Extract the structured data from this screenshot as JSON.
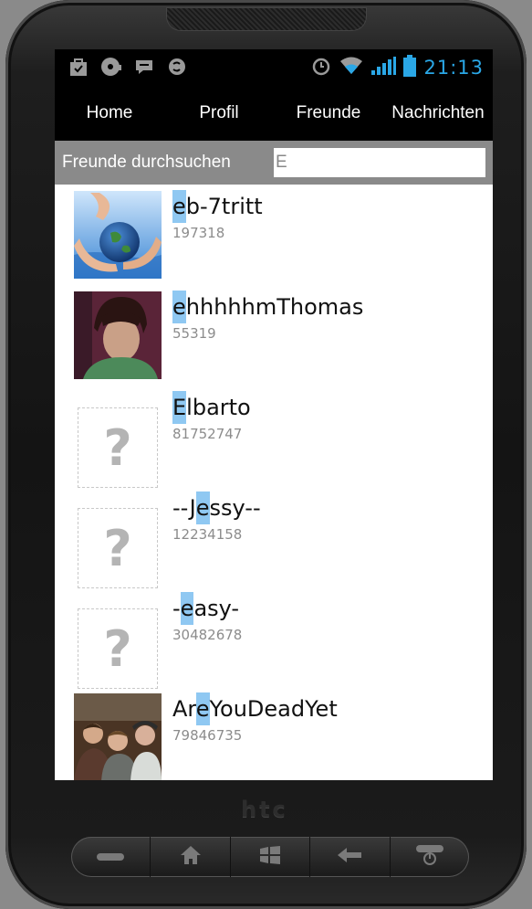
{
  "statusbar": {
    "icons_left": [
      "store-bag-icon",
      "disc-icon",
      "chat-icon",
      "skype-icon"
    ],
    "icons_right": [
      "alarm-icon",
      "wifi-icon",
      "signal-icon",
      "battery-icon"
    ],
    "time": "21:13"
  },
  "tabs": [
    {
      "label": "Home"
    },
    {
      "label": "Profil"
    },
    {
      "label": "Freunde"
    },
    {
      "label": "Nachrichten"
    }
  ],
  "search": {
    "label": "Freunde durchsuchen",
    "value": "E"
  },
  "friends": [
    {
      "pre": "",
      "hl": "e",
      "post": "b-7tritt",
      "id": "197318",
      "avatar": "globe-hands-photo"
    },
    {
      "pre": "",
      "hl": "e",
      "post": "hhhhhmThomas",
      "id": "55319",
      "avatar": "person-photo"
    },
    {
      "pre": "",
      "hl": "E",
      "post": "lbarto",
      "id": "81752747",
      "avatar": "placeholder"
    },
    {
      "pre": "--J",
      "hl": "e",
      "post": "ssy--",
      "id": "12234158",
      "avatar": "placeholder"
    },
    {
      "pre": "-",
      "hl": "e",
      "post": "asy-",
      "id": "30482678",
      "avatar": "placeholder"
    },
    {
      "pre": "Ar",
      "hl": "e",
      "post": "YouDeadYet",
      "id": "79846735",
      "avatar": "group-photo"
    }
  ],
  "placeholder_glyph": "?",
  "device": {
    "brand": "htc",
    "buttons": [
      "call-icon",
      "home-icon",
      "windows-icon",
      "back-icon",
      "end-call-icon"
    ]
  },
  "colors": {
    "clock": "#2aa7e6",
    "highlight": "#8fc8f2",
    "searchbar": "#8a8a8a"
  }
}
